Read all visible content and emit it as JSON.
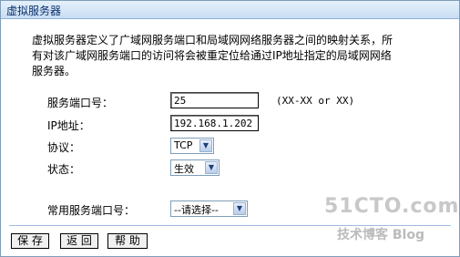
{
  "window": {
    "title": "虚拟服务器"
  },
  "description": [
    "虚拟服务器定义了广域网服务端口和局域网网络服务器之间的映射关系，所",
    "有对该广域网服务端口的访问将会被重定位给通过IP地址指定的局域网网络",
    "服务器。"
  ],
  "form": {
    "port_label": "服务端口号：",
    "port_value": "25",
    "port_hint": "(XX-XX or XX)",
    "ip_label": "IP地址：",
    "ip_value": "192.168.1.202",
    "protocol_label": "协议：",
    "protocol_selected": "TCP",
    "status_label": "状态：",
    "status_selected": "生效",
    "common_port_label": "常用服务端口号：",
    "common_port_selected": "--请选择--"
  },
  "buttons": {
    "save": "保 存",
    "back": "返 回",
    "help": "帮 助"
  },
  "watermark": {
    "site": "51CTO.com",
    "blog": "技术博客 Blog"
  },
  "colors": {
    "title_bg": "#c9def3",
    "title_text": "#0b2f6b",
    "separator": "#9ebbe0"
  }
}
